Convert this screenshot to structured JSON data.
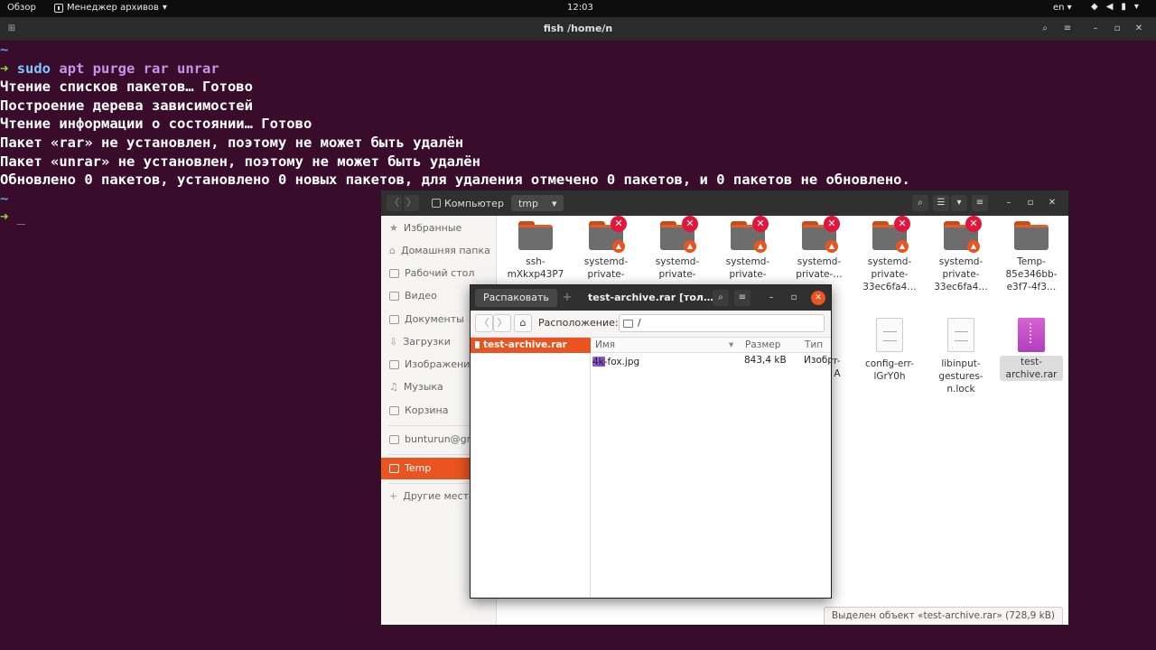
{
  "topbar": {
    "activities": "Обзор",
    "app_menu": "Менеджер архивов",
    "clock": "12:03",
    "lang": "en",
    "sys_icons": [
      "wifi-icon",
      "volume-icon",
      "battery-icon",
      "chevron-down-icon"
    ]
  },
  "terminal": {
    "title": "fish /home/n",
    "command_prefix": "sudo",
    "command_rest": "apt purge rar unrar",
    "output": [
      "Чтение списков пакетов… Готово",
      "Построение дерева зависимостей",
      "Чтение информации о состоянии… Готово",
      "Пакет «rar» не установлен, поэтому не может быть удалён",
      "Пакет «unrar» не установлен, поэтому не может быть удалён",
      "Обновлено 0 пакетов, установлено 0 новых пакетов, для удаления отмечено 0 пакетов, и 0 пакетов не обновлено."
    ],
    "tilde": "~",
    "arrow": "➜",
    "cursor": "_"
  },
  "files": {
    "path": [
      "Компьютер",
      "tmp"
    ],
    "sidebar": [
      {
        "label": "Избранные",
        "icon": "star-icon"
      },
      {
        "label": "Домашняя папка",
        "icon": "home-icon"
      },
      {
        "label": "Рабочий стол",
        "icon": "desktop-icon"
      },
      {
        "label": "Видео",
        "icon": "video-icon"
      },
      {
        "label": "Документы",
        "icon": "documents-icon"
      },
      {
        "label": "Загрузки",
        "icon": "downloads-icon"
      },
      {
        "label": "Изображения",
        "icon": "pictures-icon"
      },
      {
        "label": "Музыка",
        "icon": "music-icon"
      },
      {
        "label": "Корзина",
        "icon": "trash-icon"
      },
      {
        "label": "bunturun@gmail.com",
        "icon": "account-icon"
      },
      {
        "label": "Temp",
        "icon": "folder-icon"
      },
      {
        "label": "Другие места",
        "icon": "plus-icon"
      }
    ],
    "items_row1": [
      {
        "name": "ssh-mXkxp43P7",
        "locked": false
      },
      {
        "name": "systemd-private-",
        "locked": true
      },
      {
        "name": "systemd-private-",
        "locked": true
      },
      {
        "name": "systemd-private-",
        "locked": true
      },
      {
        "name": "systemd-private-…",
        "locked": true
      },
      {
        "name": "systemd-private-33ec6fa4…",
        "locked": true
      },
      {
        "name": "systemd-private-33ec6fa4…",
        "locked": true
      },
      {
        "name": "Temp-85e346bb-e3f7-4f3…",
        "locked": false
      }
    ],
    "items_row2": [
      {
        "name": "config-err-lGrY0h",
        "kind": "doc"
      },
      {
        "name": "libinput-gestures-n.lock",
        "kind": "doc"
      },
      {
        "name": "test-archive.rar",
        "kind": "archive"
      }
    ],
    "hidden_fragments": [
      "rr-",
      "A"
    ],
    "status": "Выделен объект «test-archive.rar» (728,9 kB)"
  },
  "archive": {
    "extract_label": "Распаковать",
    "add_label": "+",
    "title": "test-archive.rar [тол…",
    "location_label": "Расположение:",
    "location_value": "/",
    "tree_item": "test-archive.rar",
    "columns": {
      "name": "Имя",
      "size": "Размер",
      "type": "Тип"
    },
    "rows": [
      {
        "name": "4k-fox.jpg",
        "size": "843,4 kB",
        "type": "Изобр"
      }
    ]
  },
  "colors": {
    "accent": "#e95420",
    "terminal_bg": "#380c2a"
  }
}
